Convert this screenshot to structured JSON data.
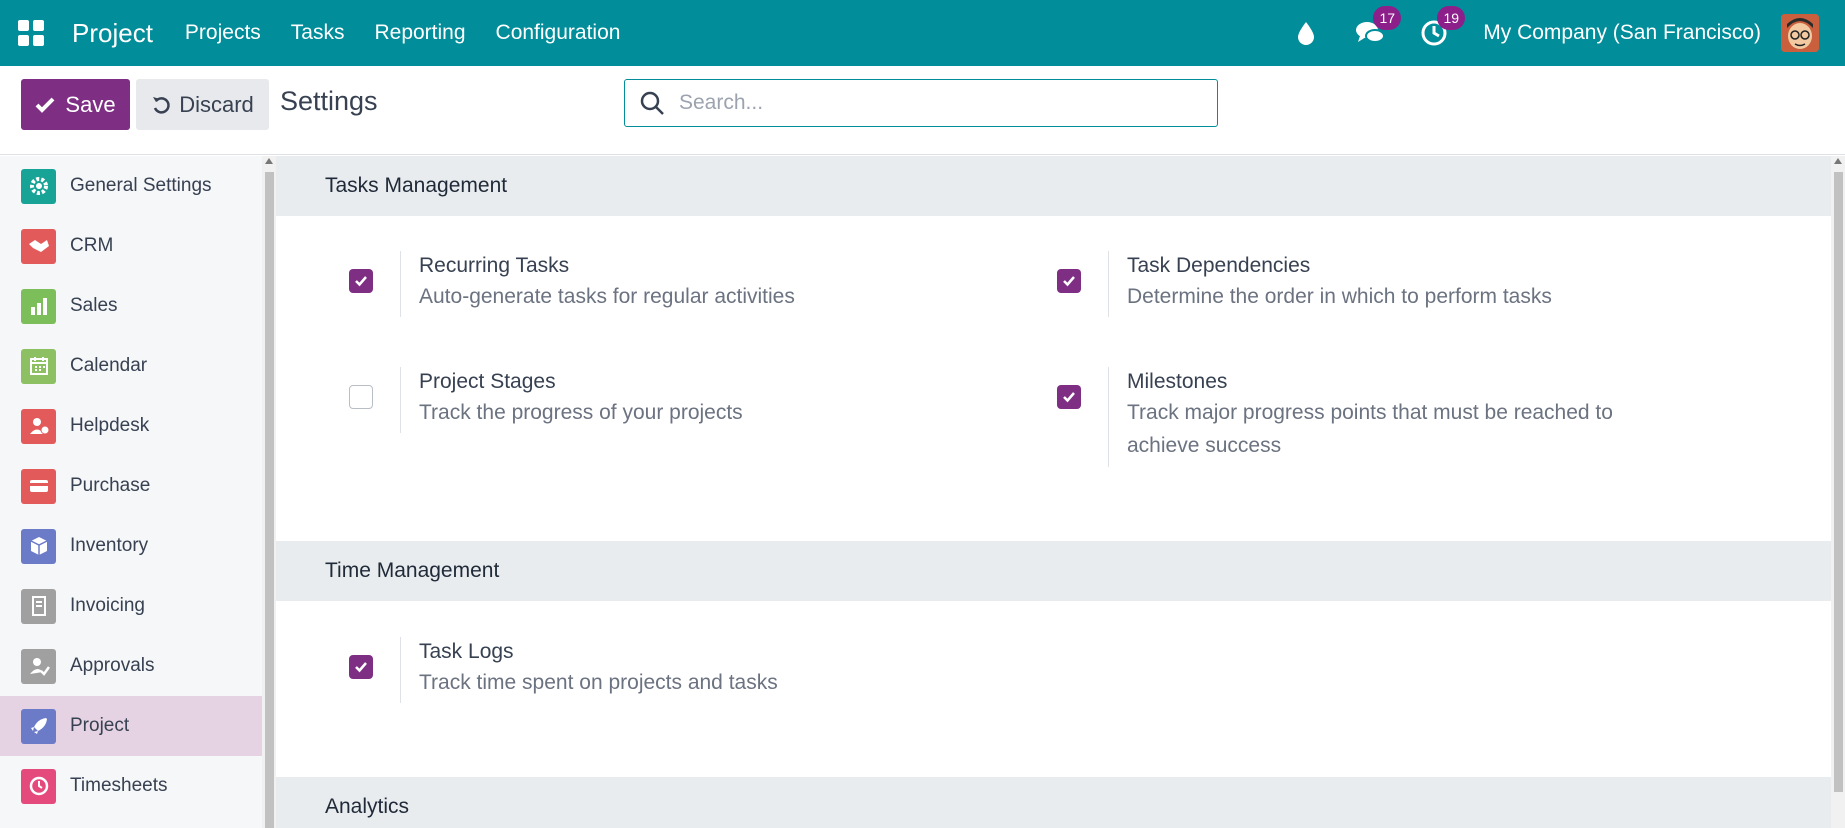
{
  "navbar": {
    "brand": "Project",
    "menu": [
      "Projects",
      "Tasks",
      "Reporting",
      "Configuration"
    ],
    "messages_count": "17",
    "activities_count": "19",
    "company": "My Company (San Francisco)",
    "bg_color": "#018d99"
  },
  "control": {
    "save_label": "Save",
    "discard_label": "Discard",
    "title": "Settings",
    "search_placeholder": "Search..."
  },
  "sidebar": {
    "items": [
      {
        "label": "General Settings",
        "icon": "gear-icon",
        "color": "#17a497"
      },
      {
        "label": "CRM",
        "icon": "handshake-icon",
        "color": "#e35a5a"
      },
      {
        "label": "Sales",
        "icon": "chart-icon",
        "color": "#7cbe59"
      },
      {
        "label": "Calendar",
        "icon": "calendar-icon",
        "color": "#8cc063"
      },
      {
        "label": "Helpdesk",
        "icon": "support-icon",
        "color": "#e35a5a"
      },
      {
        "label": "Purchase",
        "icon": "card-icon",
        "color": "#e35a5a"
      },
      {
        "label": "Inventory",
        "icon": "box-icon",
        "color": "#6c7bc8"
      },
      {
        "label": "Invoicing",
        "icon": "invoice-icon",
        "color": "#a0a0a0"
      },
      {
        "label": "Approvals",
        "icon": "approval-icon",
        "color": "#a0a0a0"
      },
      {
        "label": "Project",
        "icon": "rocket-icon",
        "color": "#6c7bc8"
      },
      {
        "label": "Timesheets",
        "icon": "clock-icon",
        "color": "#e54a7c"
      }
    ],
    "active_index": 9
  },
  "sections": {
    "tasks": {
      "title": "Tasks Management",
      "settings": [
        {
          "title": "Recurring Tasks",
          "desc": "Auto-generate tasks for regular activities",
          "checked": true
        },
        {
          "title": "Task Dependencies",
          "desc": "Determine the order in which to perform tasks",
          "checked": true
        },
        {
          "title": "Project Stages",
          "desc": "Track the progress of your projects",
          "checked": false
        },
        {
          "title": "Milestones",
          "desc": "Track major progress points that must be reached to achieve success",
          "checked": true
        }
      ]
    },
    "time": {
      "title": "Time Management",
      "settings": [
        {
          "title": "Task Logs",
          "desc": "Track time spent on projects and tasks",
          "checked": true
        }
      ]
    },
    "analytics": {
      "title": "Analytics"
    }
  },
  "colors": {
    "accent": "#7e2f84",
    "teal": "#018d99",
    "active_sidebar": "#e5d3e4"
  }
}
